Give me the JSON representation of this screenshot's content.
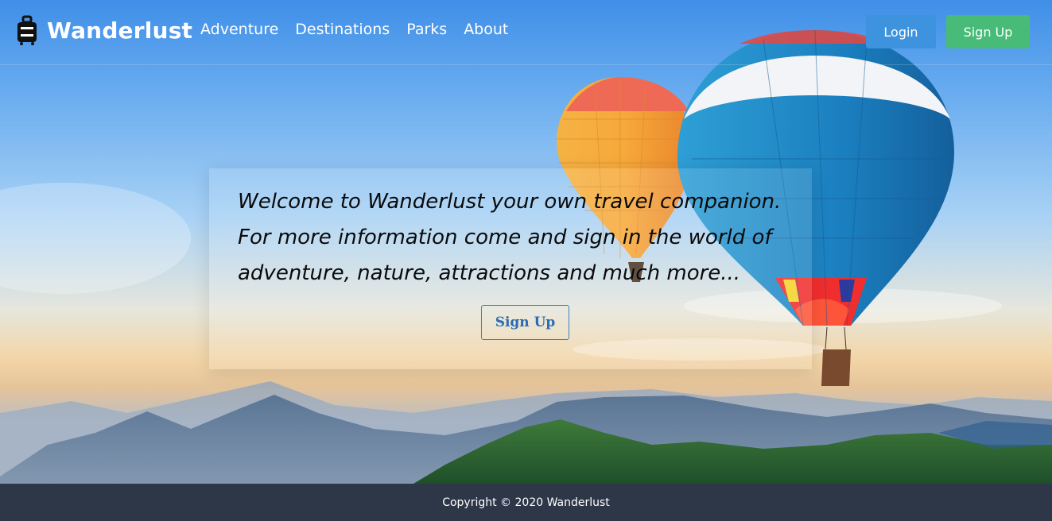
{
  "brand": {
    "name": "Wanderlust",
    "icon": "luggage-icon"
  },
  "nav": {
    "links": [
      {
        "label": "Adventure"
      },
      {
        "label": "Destinations"
      },
      {
        "label": "Parks"
      },
      {
        "label": "About"
      }
    ],
    "login_label": "Login",
    "signup_label": "Sign Up"
  },
  "hero": {
    "welcome_lines": [
      "Welcome to Wanderlust your own travel companion.",
      "For more information come and sign in the world of",
      "adventure, nature, attractions and much more..."
    ],
    "signup_label": "Sign Up",
    "background": "hot-air-balloons-over-mountains-photo"
  },
  "footer": {
    "copyright": "Copyright © 2020 Wanderlust"
  },
  "colors": {
    "login_button": "#3d93de",
    "signup_button": "#48bb78",
    "footer_bg": "#2d3748",
    "card_button_border": "#3d7fc6"
  }
}
